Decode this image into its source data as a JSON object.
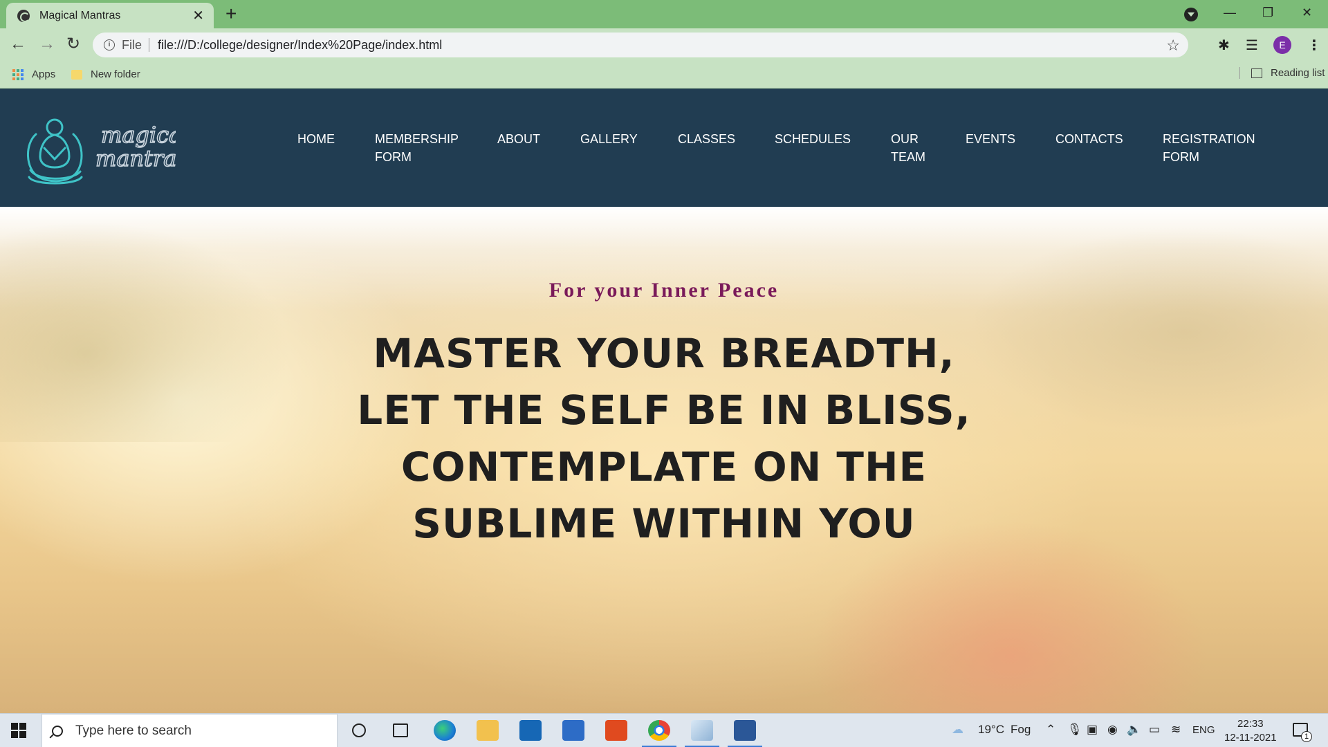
{
  "browser": {
    "tab_title": "Magical Mantras",
    "tab_close": "✕",
    "new_tab": "+",
    "url_scheme": "File",
    "url": "file:///D:/college/designer/Index%20Page/index.html",
    "profile_initial": "E",
    "bookmarks": [
      {
        "label": "Apps"
      },
      {
        "label": "New folder"
      }
    ],
    "reading_list": "Reading list"
  },
  "site": {
    "nav": [
      {
        "label": "HOME"
      },
      {
        "label": "MEMBERSHIP FORM"
      },
      {
        "label": "ABOUT"
      },
      {
        "label": "GALLERY"
      },
      {
        "label": "CLASSES"
      },
      {
        "label": "SCHEDULES"
      },
      {
        "label": "OUR TEAM"
      },
      {
        "label": "EVENTS"
      },
      {
        "label": "CONTACTS"
      },
      {
        "label": "REGISTRATION FORM"
      }
    ],
    "logo_text_1": "magical",
    "logo_text_2": "mantras",
    "tagline": "For your Inner Peace",
    "headline": "MASTER YOUR BREADTH, LET THE SELF BE IN BLISS, CONTEMPLATE ON THE SUBLIME WITHIN YOU",
    "colors": {
      "header_bg": "#213d52",
      "logo_accent": "#3fc3c7",
      "tagline": "#7a1a5a",
      "headline": "#1f1f1f"
    }
  },
  "taskbar": {
    "search_placeholder": "Type here to search",
    "weather_temp": "19°C",
    "weather_desc": "Fog",
    "language": "ENG",
    "time": "22:33",
    "date": "12-11-2021",
    "notification_count": "1"
  }
}
